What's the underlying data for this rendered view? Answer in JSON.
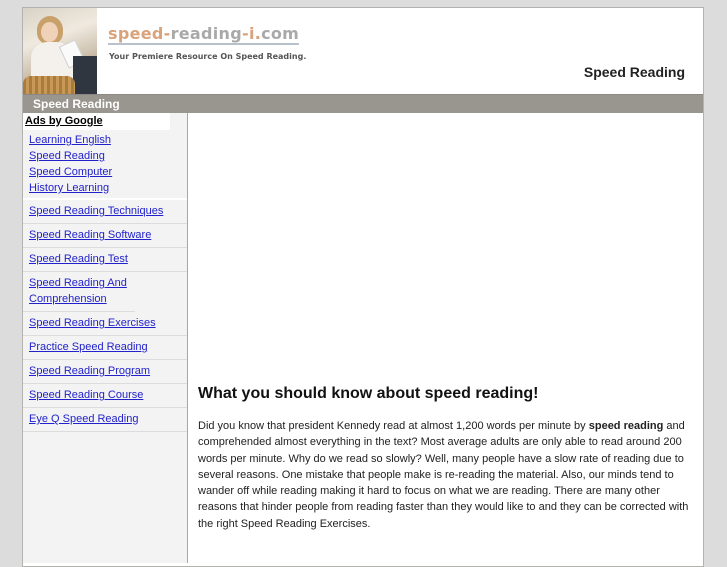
{
  "header": {
    "logo": {
      "part1": "speed-",
      "part2": "reading",
      "part3": "-i.",
      "part4": "com"
    },
    "tagline": "Your Premiere Resource On Speed Reading.",
    "site_title": "Speed Reading"
  },
  "navbar": {
    "title": "Speed Reading"
  },
  "sidebar": {
    "ads_label": "Ads by Google",
    "ad_links": [
      "Learning English",
      "Speed Reading",
      "Speed Computer",
      "History Learning"
    ],
    "links": [
      "Speed Reading Techniques",
      "Speed Reading Software",
      "Speed Reading Test",
      "Speed Reading And Comprehension",
      "Speed Reading Exercises",
      "Practice Speed Reading",
      "Speed Reading Program",
      "Speed Reading Course",
      "Eye Q Speed Reading"
    ]
  },
  "main": {
    "heading": "What you should know about speed reading!",
    "para_start": "Did you know that president Kennedy read at almost 1,200 words per minute by ",
    "para_bold": "speed reading",
    "para_end": " and comprehended almost everything in the text? Most average adults are only able to read around 200 words per minute. Why do we read so slowly? Well, many people have a slow rate of reading due to several reasons. One mistake that people make is re-reading the material. Also, our minds tend to wander off while reading making it hard to focus on what we are reading. There are many other reasons that hinder people from reading faster than they would like to and they can be corrected with the right Speed Reading Exercises."
  },
  "colors": {
    "page_bg": "#dcdcdc",
    "navbar_bg": "#99958f",
    "link": "#2222cc",
    "logo_orange": "#d9a27a",
    "logo_gray": "#a9a9a9"
  }
}
